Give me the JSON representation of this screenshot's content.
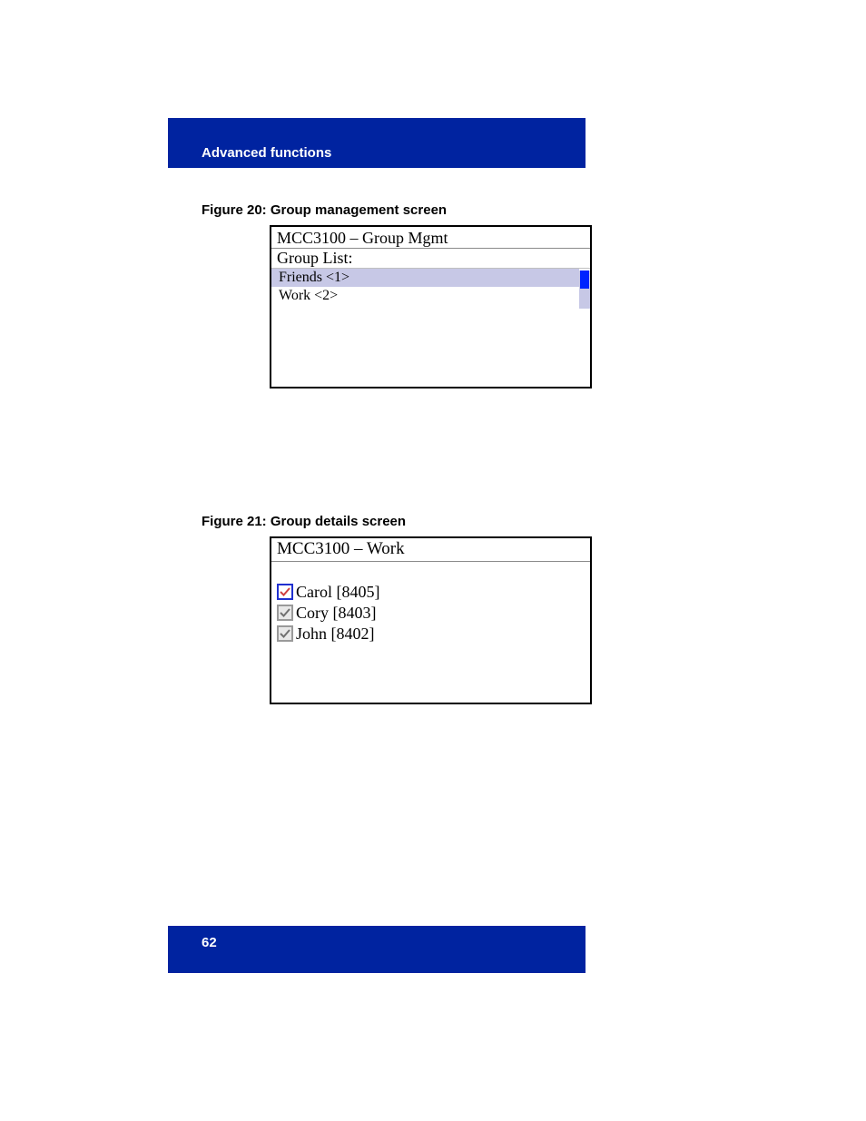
{
  "header": {
    "title": "Advanced functions"
  },
  "figure20": {
    "caption": "Figure 20: Group management screen",
    "windowTitle": "MCC3100 – Group Mgmt",
    "listLabel": "Group List:",
    "items": [
      {
        "label": "Friends <1>",
        "selected": true
      },
      {
        "label": "Work <2>",
        "selected": false
      }
    ]
  },
  "figure21": {
    "caption": "Figure 21: Group details screen",
    "windowTitle": "MCC3100 – Work",
    "members": [
      {
        "name": "Carol [8405]",
        "checkState": "selected"
      },
      {
        "name": "Cory [8403]",
        "checkState": "checked"
      },
      {
        "name": "John [8402]",
        "checkState": "checked"
      }
    ]
  },
  "footer": {
    "pageNumber": "62"
  }
}
